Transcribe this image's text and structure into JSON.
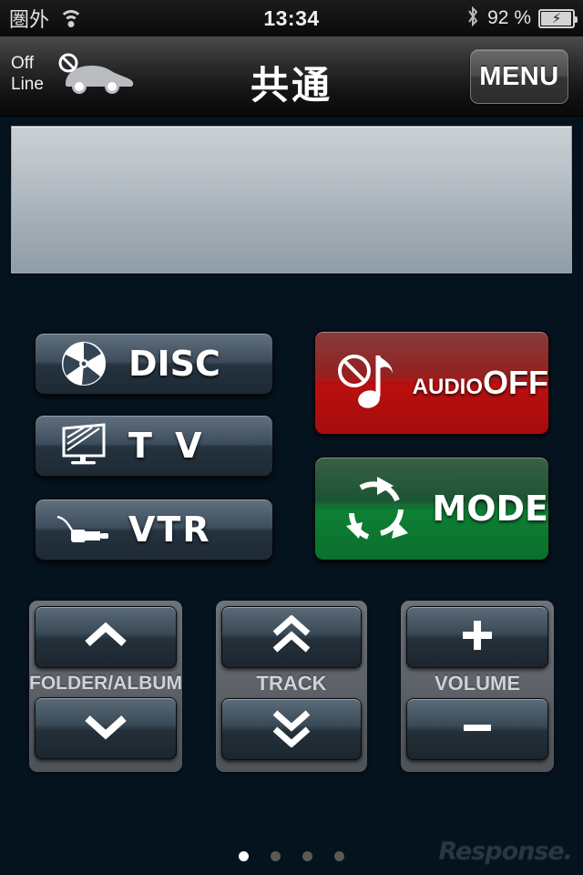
{
  "status_bar": {
    "carrier": "圏外",
    "wifi_icon": "wifi-icon",
    "clock": "13:34",
    "bluetooth_icon": "bluetooth-icon",
    "battery_percent": "92 %",
    "battery_icon": "battery-charging-icon"
  },
  "header": {
    "offline_line1": "Off",
    "offline_line2": "Line",
    "car_icon": "car-prohibited-icon",
    "title": "共通",
    "menu_label": "MENU"
  },
  "display_panel": {
    "content": ""
  },
  "source_buttons": [
    {
      "id": "disc",
      "label": "DISC",
      "icon": "disc-icon",
      "color": "#334454"
    },
    {
      "id": "tv",
      "label": "T V",
      "icon": "tv-icon",
      "color": "#334454"
    },
    {
      "id": "vtr",
      "label": "VTR",
      "icon": "plug-icon",
      "color": "#334454"
    }
  ],
  "action_buttons": {
    "audio_off": {
      "label_small": "AUDIO",
      "label_large": "OFF",
      "icon": "audio-mute-note-icon",
      "color": "#bb0f0f"
    },
    "mode": {
      "label": "MODE",
      "icon": "refresh-cycle-icon",
      "color": "#0d8134"
    }
  },
  "control_groups": [
    {
      "id": "folder",
      "label": "FOLDER/ALBUM",
      "up_icon": "chevron-up-icon",
      "down_icon": "chevron-down-icon"
    },
    {
      "id": "track",
      "label": "TRACK",
      "up_icon": "double-chevron-up-icon",
      "down_icon": "double-chevron-down-icon"
    },
    {
      "id": "volume",
      "label": "VOLUME",
      "up_icon": "plus-icon",
      "down_icon": "minus-icon"
    }
  ],
  "pagination": {
    "total": 4,
    "active_index": 0
  },
  "watermark": "Response."
}
